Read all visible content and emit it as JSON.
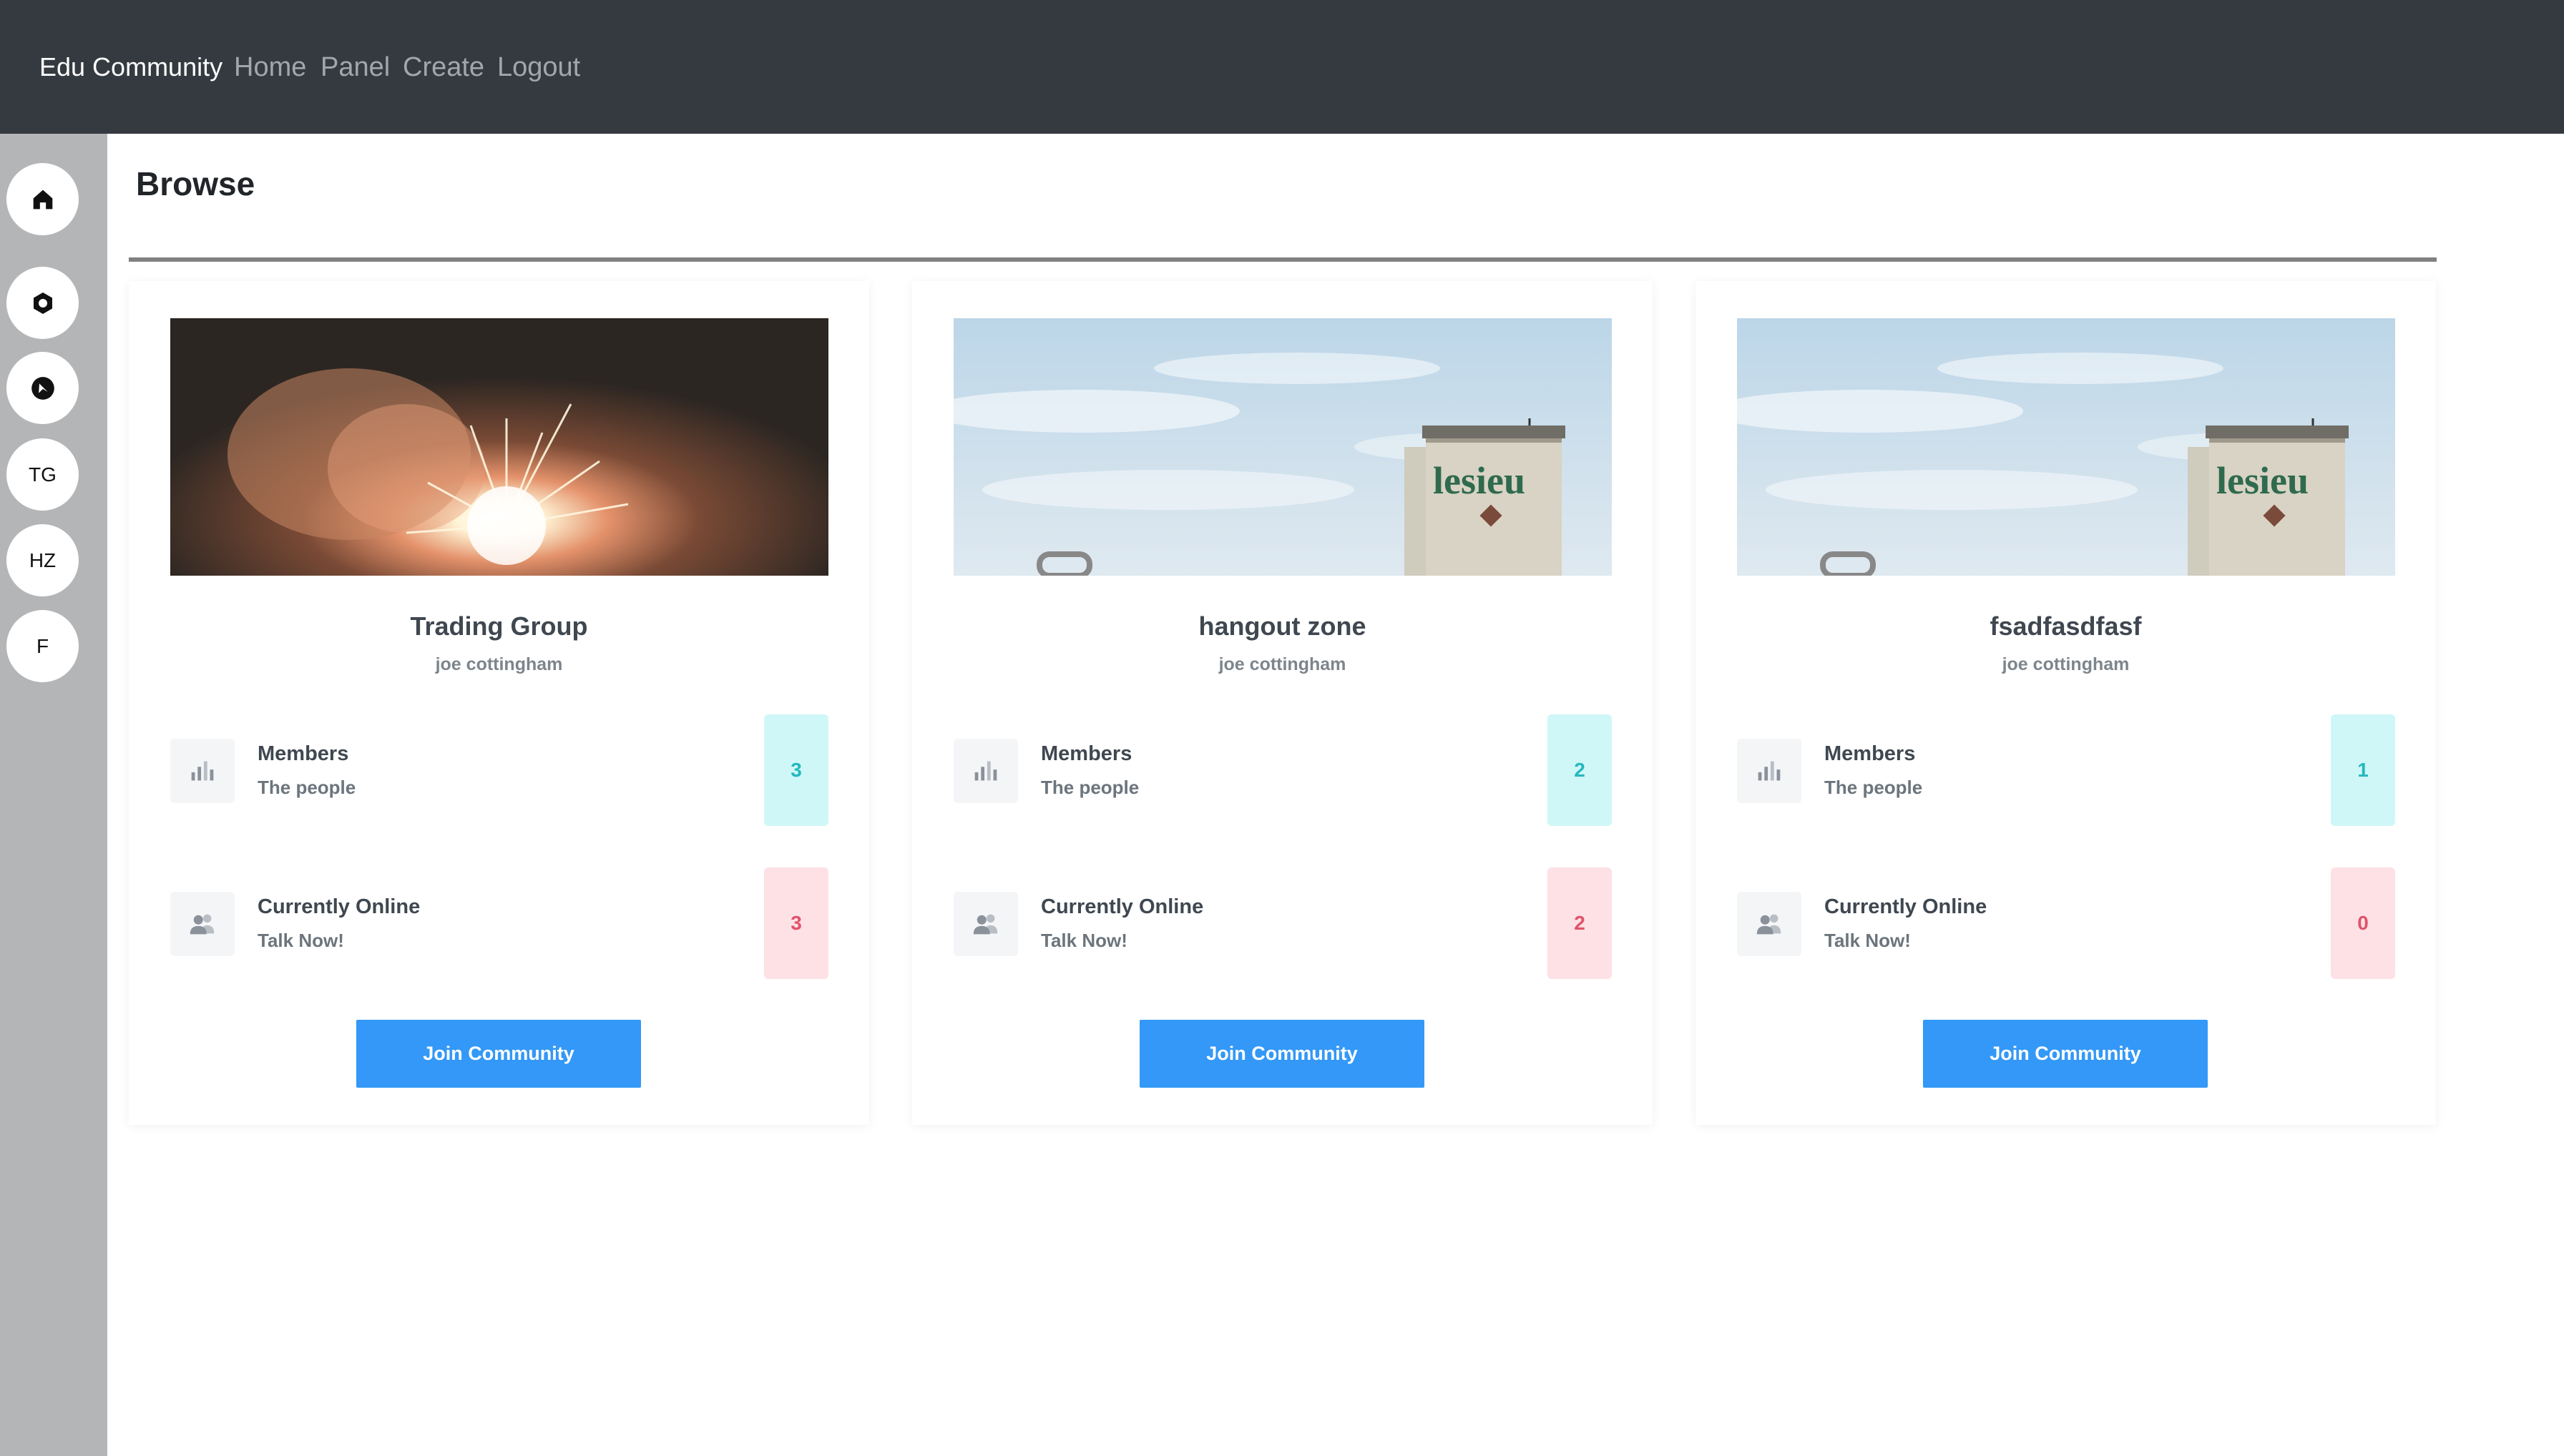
{
  "navbar": {
    "brand": "Edu Community",
    "links": [
      "Home",
      "Panel",
      "Create",
      "Logout"
    ]
  },
  "sidebar": {
    "items": [
      {
        "icon": "home-icon",
        "label": ""
      },
      {
        "icon": "gear-icon",
        "label": ""
      },
      {
        "icon": "compass-icon",
        "label": ""
      },
      {
        "icon": "",
        "label": "TG"
      },
      {
        "icon": "",
        "label": "HZ"
      },
      {
        "icon": "",
        "label": "F"
      }
    ]
  },
  "main": {
    "title": "Browse"
  },
  "cards": [
    {
      "image": "sparkler-photo",
      "title": "Trading Group",
      "owner": "joe cottingham",
      "members_label": "Members",
      "members_sub": "The people",
      "members_count": "3",
      "online_label": "Currently Online",
      "online_sub": "Talk Now!",
      "online_count": "3",
      "button": "Join Community"
    },
    {
      "image": "silo-photo",
      "title": "hangout zone",
      "owner": "joe cottingham",
      "members_label": "Members",
      "members_sub": "The people",
      "members_count": "2",
      "online_label": "Currently Online",
      "online_sub": "Talk Now!",
      "online_count": "2",
      "button": "Join Community"
    },
    {
      "image": "silo-photo",
      "title": "fsadfasdfasf",
      "owner": "joe cottingham",
      "members_label": "Members",
      "members_sub": "The people",
      "members_count": "1",
      "online_label": "Currently Online",
      "online_sub": "Talk Now!",
      "online_count": "0",
      "button": "Join Community"
    }
  ],
  "silo_text": "lesieu",
  "colors": {
    "navbar": "#343a40",
    "sidebar": "#b4b5b7",
    "button": "#3398f7",
    "members_badge_bg": "#cff7f7",
    "members_badge_text": "#24b8c0",
    "online_badge_bg": "#fde1e5",
    "online_badge_text": "#e0536a"
  }
}
